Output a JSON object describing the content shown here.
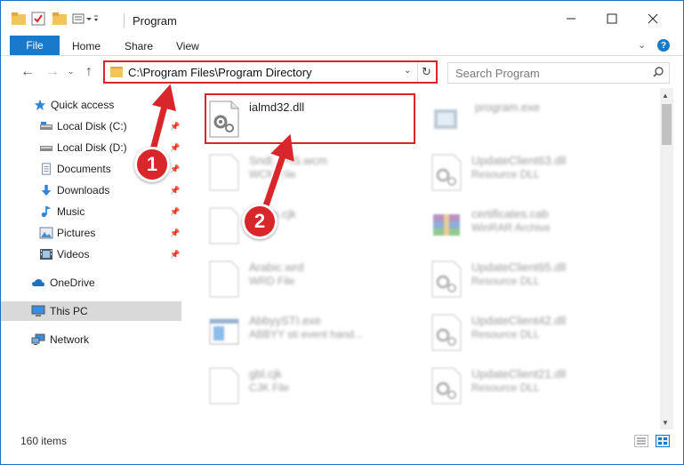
{
  "window": {
    "title": "Program"
  },
  "ribbon": {
    "file_label": "File",
    "tabs": [
      {
        "label": "Home"
      },
      {
        "label": "Share"
      },
      {
        "label": "View"
      }
    ],
    "help_label": "?"
  },
  "address_bar": {
    "path": "C:\\Program Files\\Program Directory"
  },
  "search": {
    "placeholder": "Search Program"
  },
  "sidebar": {
    "items": [
      {
        "label": "Quick access",
        "icon": "star-icon"
      },
      {
        "label": "Local Disk (C:)",
        "icon": "drive-icon",
        "pinned": true
      },
      {
        "label": "Local Disk (D:)",
        "icon": "drive-icon",
        "pinned": true
      },
      {
        "label": "Documents",
        "icon": "documents-icon",
        "pinned": true
      },
      {
        "label": "Downloads",
        "icon": "download-icon",
        "pinned": true
      },
      {
        "label": "Music",
        "icon": "music-icon",
        "pinned": true
      },
      {
        "label": "Pictures",
        "icon": "pictures-icon",
        "pinned": true
      },
      {
        "label": "Videos",
        "icon": "videos-icon",
        "pinned": true
      },
      {
        "label": "OneDrive",
        "icon": "cloud-icon"
      },
      {
        "label": "This PC",
        "icon": "computer-icon",
        "selected": true
      },
      {
        "label": "Network",
        "icon": "network-icon"
      }
    ]
  },
  "files": [
    {
      "name": "ialmd32.dll",
      "type": "",
      "icon": "dll-gear-icon",
      "highlighted": true
    },
    {
      "name": "program.exe",
      "type": "",
      "icon": "exe-icon"
    },
    {
      "name": "Sndl...PIS.wcm",
      "type": "WCM File",
      "icon": "blank-file-icon"
    },
    {
      "name": "UpdateClient63.dll",
      "type": "Resource DLL",
      "icon": "dll-gear-icon"
    },
    {
      "name": "...rom.cjk",
      "type": "...",
      "icon": "blank-file-icon"
    },
    {
      "name": "certificates.cab",
      "type": "WinRAR Archive",
      "icon": "archive-icon"
    },
    {
      "name": "Arabic.wrd",
      "type": "WRD File",
      "icon": "blank-file-icon"
    },
    {
      "name": "UpdateClient65.dll",
      "type": "Resource DLL",
      "icon": "dll-gear-icon"
    },
    {
      "name": "AbbyySTI.exe",
      "type": "ABBYY sti event hand...",
      "icon": "app-window-icon"
    },
    {
      "name": "UpdateClient42.dll",
      "type": "Resource DLL",
      "icon": "dll-gear-icon"
    },
    {
      "name": "gbl.cjk",
      "type": "CJK File",
      "icon": "blank-file-icon"
    },
    {
      "name": "UpdateClient21.dll",
      "type": "Resource DLL",
      "icon": "dll-gear-icon"
    }
  ],
  "status": {
    "item_count": "160 items"
  },
  "callouts": [
    {
      "number": "1"
    },
    {
      "number": "2"
    }
  ],
  "colors": {
    "accent": "#1979ca",
    "highlight_red": "#d8262b",
    "selected_bg": "#d9d9d9"
  }
}
